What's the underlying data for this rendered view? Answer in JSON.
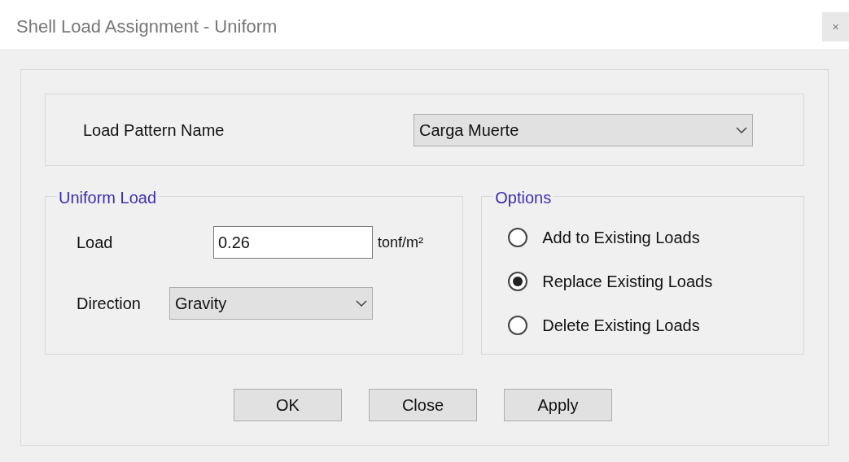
{
  "window": {
    "title": "Shell Load Assignment - Uniform",
    "close": "×"
  },
  "load_pattern": {
    "label": "Load Pattern Name",
    "value": "Carga Muerte"
  },
  "uniform_load": {
    "title": "Uniform Load",
    "load_label": "Load",
    "load_value": "0.26",
    "unit": "tonf/m²",
    "direction_label": "Direction",
    "direction_value": "Gravity"
  },
  "options": {
    "title": "Options",
    "items": [
      {
        "label": "Add to Existing Loads",
        "selected": false
      },
      {
        "label": "Replace Existing Loads",
        "selected": true
      },
      {
        "label": "Delete Existing Loads",
        "selected": false
      }
    ]
  },
  "buttons": [
    "OK",
    "Close",
    "Apply"
  ]
}
